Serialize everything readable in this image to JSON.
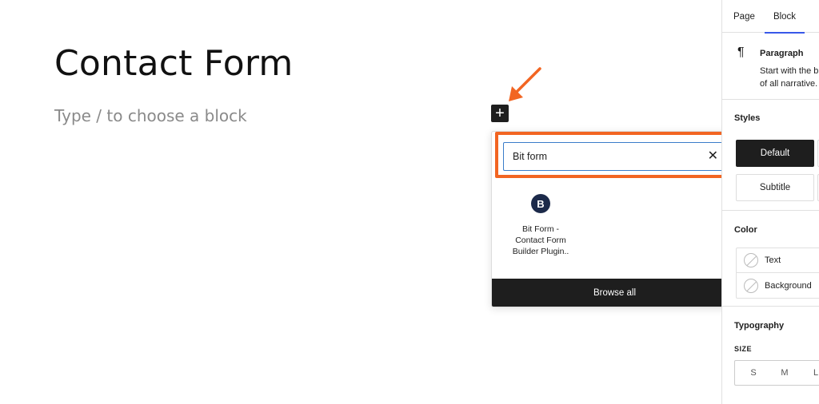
{
  "editor": {
    "title": "Contact Form",
    "placeholder": "Type / to choose a block",
    "inserter_toggle": "+"
  },
  "quick_inserter": {
    "search_value": "Bit form",
    "clear": "✕",
    "result": {
      "icon_letter": "B",
      "label": "Bit Form -\nContact Form\nBuilder Plugin.."
    },
    "browse_all": "Browse all"
  },
  "sidebar": {
    "tabs": {
      "page": "Page",
      "block": "Block"
    },
    "block_card": {
      "icon": "¶",
      "name": "Paragraph",
      "description": "Start with the b\nof all narrative."
    },
    "styles": {
      "title": "Styles",
      "default": "Default",
      "subtitle": "Subtitle"
    },
    "color": {
      "title": "Color",
      "text": "Text",
      "background": "Background"
    },
    "typography": {
      "title": "Typography",
      "size_label": "SIZE",
      "sizes": [
        "S",
        "M",
        "L"
      ]
    }
  },
  "colors": {
    "highlight": "#f26522",
    "accent": "#3858e9",
    "dark": "#1e1e1e"
  }
}
